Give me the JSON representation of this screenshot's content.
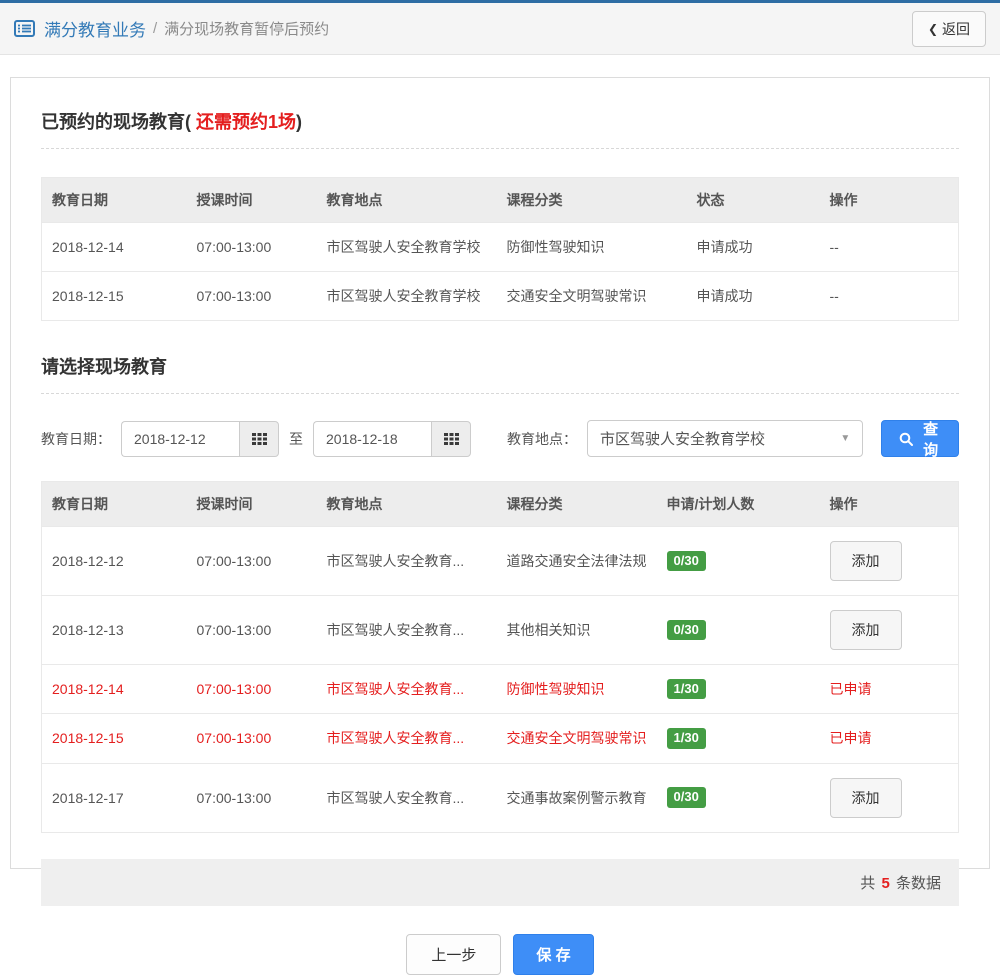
{
  "topbar": {
    "breadcrumb_root": "满分教育业务",
    "breadcrumb_sep": "/",
    "breadcrumb_current": "满分现场教育暂停后预约",
    "back_chevron": "❮",
    "back_label": "返回"
  },
  "booked_section": {
    "title_prefix": "已预约的现场教育(",
    "title_highlight": " 还需预约1场",
    "title_suffix": ")",
    "columns": [
      "教育日期",
      "授课时间",
      "教育地点",
      "课程分类",
      "状态",
      "操作"
    ],
    "rows": [
      {
        "date": "2018-12-14",
        "time": "07:00-13:00",
        "place": "市区驾驶人安全教育学校",
        "course": "防御性驾驶知识",
        "status": "申请成功",
        "action": "--"
      },
      {
        "date": "2018-12-15",
        "time": "07:00-13:00",
        "place": "市区驾驶人安全教育学校",
        "course": "交通安全文明驾驶常识",
        "status": "申请成功",
        "action": "--"
      }
    ]
  },
  "select_section": {
    "title": "请选择现场教育",
    "filter": {
      "date_label": "教育日期：",
      "date_from": "2018-12-12",
      "range_sep": "至",
      "date_to": "2018-12-18",
      "place_label": "教育地点：",
      "place_value": "市区驾驶人安全教育学校",
      "caret_glyph": "▼",
      "search_label": "查询"
    },
    "columns": [
      "教育日期",
      "授课时间",
      "教育地点",
      "课程分类",
      "申请/计划人数",
      "操作"
    ],
    "rows": [
      {
        "date": "2018-12-12",
        "time": "07:00-13:00",
        "place": "市区驾驶人安全教育...",
        "course": "道路交通安全法律法规",
        "count": "0/30",
        "add_label": "添加",
        "applied_label": "已申请",
        "applied": false
      },
      {
        "date": "2018-12-13",
        "time": "07:00-13:00",
        "place": "市区驾驶人安全教育...",
        "course": "其他相关知识",
        "count": "0/30",
        "add_label": "添加",
        "applied_label": "已申请",
        "applied": false
      },
      {
        "date": "2018-12-14",
        "time": "07:00-13:00",
        "place": "市区驾驶人安全教育...",
        "course": "防御性驾驶知识",
        "count": "1/30",
        "add_label": "添加",
        "applied_label": "已申请",
        "applied": true
      },
      {
        "date": "2018-12-15",
        "time": "07:00-13:00",
        "place": "市区驾驶人安全教育...",
        "course": "交通安全文明驾驶常识",
        "count": "1/30",
        "add_label": "添加",
        "applied_label": "已申请",
        "applied": true
      },
      {
        "date": "2018-12-17",
        "time": "07:00-13:00",
        "place": "市区驾驶人安全教育...",
        "course": "交通事故案例警示教育",
        "count": "0/30",
        "add_label": "添加",
        "applied_label": "已申请",
        "applied": false
      }
    ],
    "footer": {
      "total_prefix": "共",
      "total_count": "5",
      "total_suffix": "条数据"
    }
  },
  "actions": {
    "prev_label": "上一步",
    "save_label": "保 存"
  },
  "colors": {
    "accent_blue": "#3e8ef7",
    "link_blue": "#337ab7",
    "alert_red": "#e41e1e",
    "badge_green": "#449d44",
    "topbar_border": "#2e6da4"
  }
}
